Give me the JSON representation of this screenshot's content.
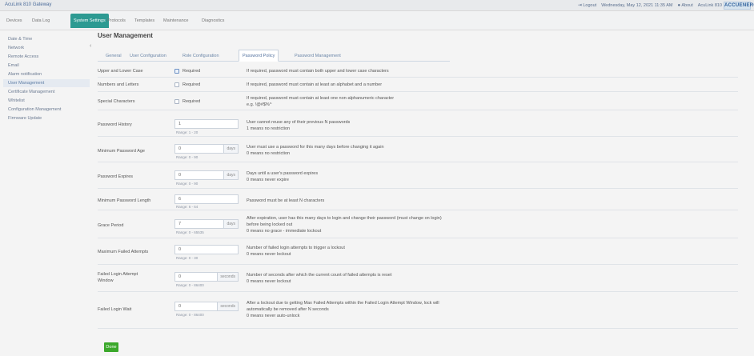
{
  "app": {
    "title": "AcuLink 810 Gateway",
    "logout": "Logout",
    "datetime": "Wednesday, May 12, 2021 11:35 AM",
    "about": "About",
    "device": "AcuLink 810",
    "brand": "ACCUENERGY"
  },
  "nav": [
    "Devices",
    "Data Log",
    "System Settings",
    "Protocols",
    "Templates",
    "Maintenance",
    "Diagnostics"
  ],
  "sidebar": [
    "Date & Time",
    "Network",
    "Remote Access",
    "Email",
    "Alarm notification",
    "User Management",
    "Certificate Management",
    "Whitelist",
    "Configuration Management",
    "Firmware Update"
  ],
  "page": {
    "heading": "User Management"
  },
  "tabs": [
    "General",
    "User Configuration",
    "Role Configuration",
    "Password Policy",
    "Password Management"
  ],
  "form": {
    "upper_lower": {
      "label": "Upper and Lower Case",
      "check": "Required",
      "desc": "If required, password must contain both upper and lower case characters"
    },
    "numbers_letters": {
      "label": "Numbers and Letters",
      "check": "Required",
      "desc": "If required, password must contain at least an alphabet and a number"
    },
    "special": {
      "label": "Special Characters",
      "check": "Required",
      "desc1": "If required, password must contain at least one non-alphanumeric character",
      "desc2": "e.g. !@#$%^"
    },
    "history": {
      "label": "Password History",
      "value": "1",
      "range": "Range: 1 - 20",
      "desc1": "User cannot reuse any of their previous N passwords",
      "desc2": "1 means no restriction"
    },
    "min_age": {
      "label": "Minimum Password Age",
      "value": "0",
      "unit": "days",
      "range": "Range: 0 - 90",
      "desc1": "User must use a password for this many days before changing it again",
      "desc2": "0 means no restriction"
    },
    "expires": {
      "label": "Password Expires",
      "value": "0",
      "unit": "days",
      "range": "Range: 0 - 90",
      "desc1": "Days until a user's password expires",
      "desc2": "0 means never expire"
    },
    "min_length": {
      "label": "Minimum Password Length",
      "value": "6",
      "range": "Range: 6 - 64",
      "desc1": "Password must be at least N characters"
    },
    "grace": {
      "label": "Grace Period",
      "value": "7",
      "unit": "days",
      "range": "Range: 0 - 65535",
      "desc1": "After expiration, user has this many days to login and change their password (must change on login)",
      "desc2": "before being locked out",
      "desc3": "0 means no grace - immediate lockout"
    },
    "max_failed": {
      "label": "Maximum Failed Attempts",
      "value": "0",
      "range": "Range: 0 - 30",
      "desc1": "Number of failed login attempts to trigger a lockout",
      "desc2": "0 means never lockout"
    },
    "failed_window": {
      "label1": "Failed Login Attempt",
      "label2": "Window",
      "value": "0",
      "unit": "seconds",
      "range": "Range: 0 - 86400",
      "desc1": "Number of seconds after which the current count of failed attempts is reset",
      "desc2": "0 means never lockout"
    },
    "failed_wait": {
      "label": "Failed Login Wait",
      "value": "0",
      "unit": "seconds",
      "range": "Range: 0 - 86400",
      "desc1": "After a lockout due to getting Max Failed Attempts within the Failed Login Attempt Window, lock will",
      "desc2": "automatically be removed after N seconds",
      "desc3": "0 means never auto-unlock"
    }
  },
  "done_label": "Done"
}
